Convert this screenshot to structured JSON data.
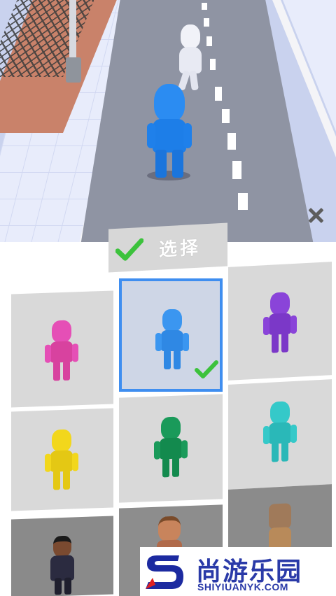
{
  "scene": {
    "player_color": "#2a8bf0",
    "ghost_color": "#eef0f8",
    "road_color": "#8f94a3"
  },
  "panel": {
    "select_button": {
      "label": "选择",
      "check_icon": "check-icon",
      "check_color": "#3cc23c"
    },
    "close_icon": "close-icon",
    "selected_border_color": "#3f8ef0",
    "skins": [
      {
        "color": "#e54fb6",
        "selected": false
      },
      {
        "color": "#3b96f0",
        "selected": true
      },
      {
        "color": "#8a44d9",
        "selected": false
      },
      {
        "color": "#f2d71c",
        "selected": false
      },
      {
        "color": "#1a9a5a",
        "selected": false
      },
      {
        "color": "#35c9c9",
        "selected": false
      },
      {
        "color": "#2b2b40",
        "selected": false
      },
      {
        "color": "#b06a4a",
        "selected": false
      },
      {
        "color": "#a07a5a",
        "selected": false
      }
    ]
  },
  "watermark": {
    "title": "尚游乐园",
    "url": "SHIYIUANYK.COM"
  }
}
